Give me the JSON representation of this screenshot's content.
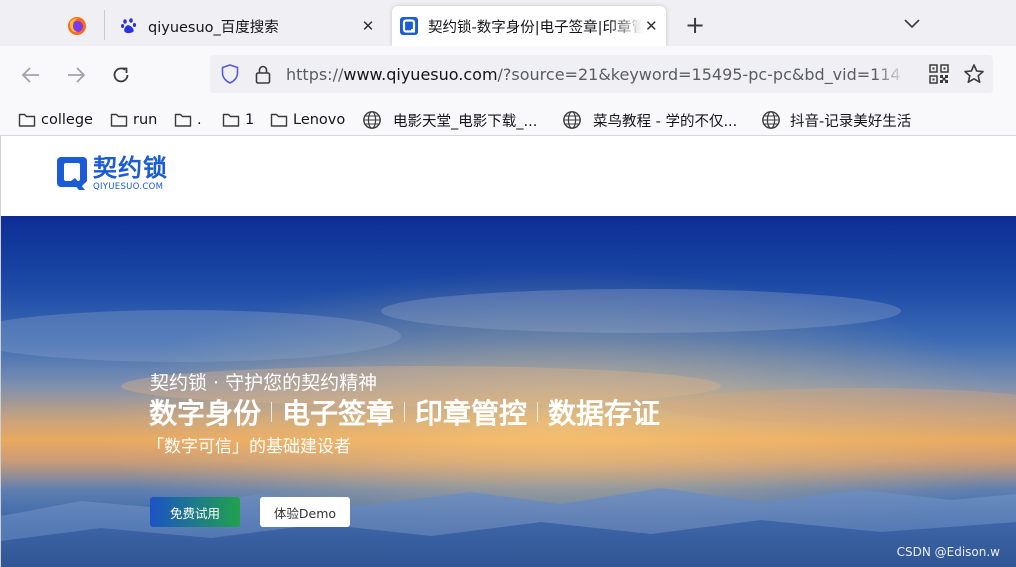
{
  "browser": {
    "tabs": [
      {
        "title": "qiyuesuo_百度搜索",
        "close": "✕"
      },
      {
        "title": "契约锁-数字身份|电子签章|印章管控|数据存证",
        "close": "✕"
      }
    ],
    "new_tab": "+",
    "url": {
      "scheme": "https://",
      "host": "www.qiyuesuo.com",
      "rest": "/?source=21&keyword=15495-pc-pc&bd_vid=114"
    }
  },
  "bookmarks": [
    {
      "label": "college",
      "icon": "folder-icon"
    },
    {
      "label": "run",
      "icon": "folder-icon"
    },
    {
      "label": ".",
      "icon": "folder-icon"
    },
    {
      "label": "1",
      "icon": "folder-icon"
    },
    {
      "label": "Lenovo",
      "icon": "folder-icon"
    },
    {
      "label": "电影天堂_电影下载_...",
      "icon": "globe-icon"
    },
    {
      "label": "菜鸟教程 - 学的不仅...",
      "icon": "globe-icon"
    },
    {
      "label": "抖音-记录美好生活",
      "icon": "globe-icon"
    }
  ],
  "site": {
    "logo_cn": "契约锁",
    "logo_en": "QIYUESUO.COM",
    "hero": {
      "subtitle": "契约锁 · 守护您的契约精神",
      "title_parts": [
        "数字身份",
        "电子签章",
        "印章管控",
        "数据存证"
      ],
      "tagline": "「数字可信」的基础建设者",
      "primary_button": "免费试用",
      "secondary_button": "体验Demo"
    }
  },
  "watermark": "CSDN @Edison.w",
  "colors": {
    "brand": "#1a5bd6",
    "trial_gradient_start": "#1c53c4",
    "trial_gradient_end": "#20a24c"
  }
}
